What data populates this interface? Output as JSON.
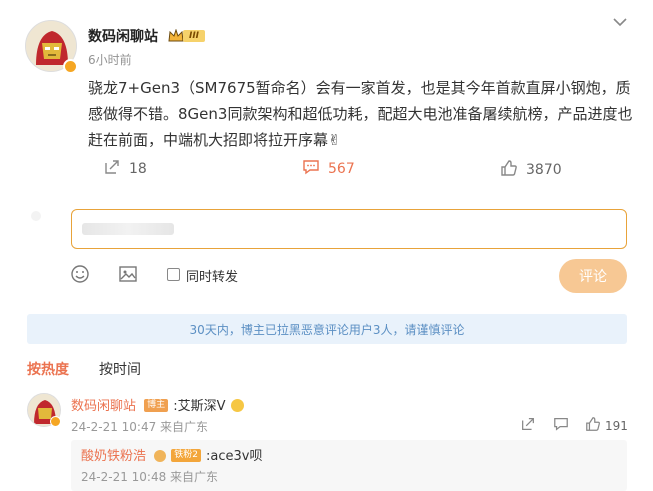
{
  "post": {
    "author": "数码闲聊站",
    "time": "6小时前",
    "level_badge": "III",
    "content": "骁龙7+Gen3（SM7675暂命名）会有一家首发，也是其今年首款直屏小钢炮，质感做得不错。8Gen3同款架构和超低功耗，配超大电池准备屠续航榜，产品进度也赶在前面，中端机大招即将拉开序幕✌",
    "reposts": "18",
    "comments": "567",
    "likes": "3870"
  },
  "reply_box": {
    "also_repost": "同时转发",
    "submit": "评论"
  },
  "notice": "30天内，博主已拉黑恶意评论用户3人，请谨慎评论",
  "tabs": {
    "hot": "按热度",
    "time": "按时间"
  },
  "comments": [
    {
      "author": "数码闲聊站",
      "badge": "博主",
      "text": ":艾斯深V",
      "time": "24-2-21 10:47 来自广东",
      "likes": "191",
      "reply": {
        "author": "酸奶铁粉浩",
        "badge": "铁粉2",
        "text": ":ace3v呗",
        "time": "24-2-21 10:48 来自广东"
      }
    }
  ],
  "colors": {
    "accent": "#eb7350",
    "submit_disabled": "#f7c894",
    "notice_bg": "#e9f2fb"
  }
}
